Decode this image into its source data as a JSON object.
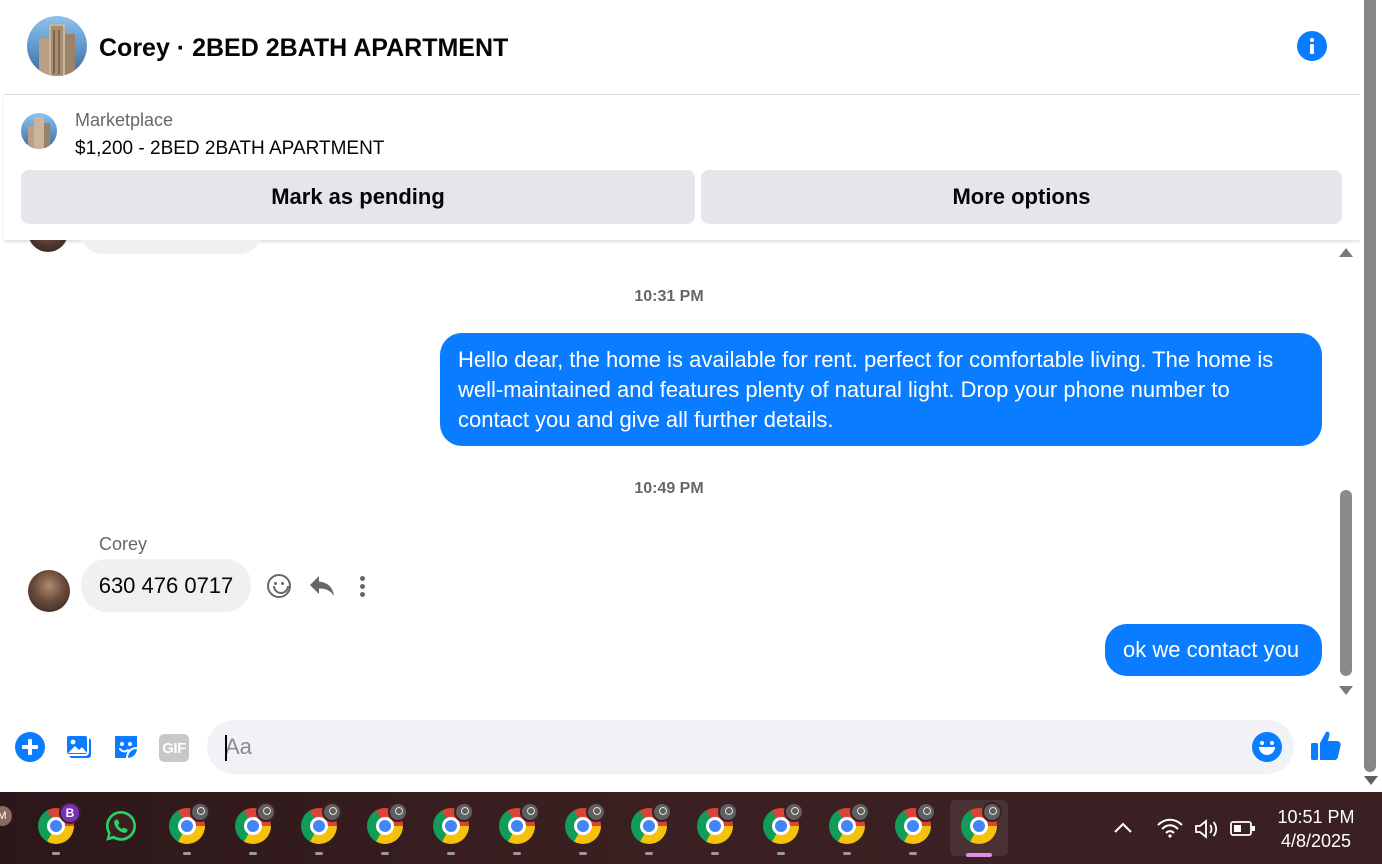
{
  "header": {
    "title": "Corey · 2BED 2BATH APARTMENT"
  },
  "marketplace": {
    "label": "Marketplace",
    "listing": "$1,200 - 2BED 2BATH APARTMENT",
    "mark_pending": "Mark as pending",
    "more_options": "More options"
  },
  "messages": {
    "time1": "10:31 PM",
    "outgoing1": "Hello dear,  the home is available for rent. perfect for comfortable living. The home is well-maintained and features plenty of natural light. Drop your phone number to contact you and give all further details.",
    "time2": "10:49 PM",
    "sender": "Corey",
    "incoming1": "630 476 0717",
    "outgoing2": "ok we contact you"
  },
  "composer": {
    "placeholder": "Aa",
    "gif_label": "GIF"
  },
  "taskbar": {
    "profile_badge": "B",
    "profile_stub": "M",
    "time": "10:51 PM",
    "date": "4/8/2025"
  },
  "colors": {
    "accent": "#0a7cff",
    "bubble_in": "#f0f0f0",
    "button_bg": "#e4e6eb",
    "muted_text": "#65676b"
  }
}
